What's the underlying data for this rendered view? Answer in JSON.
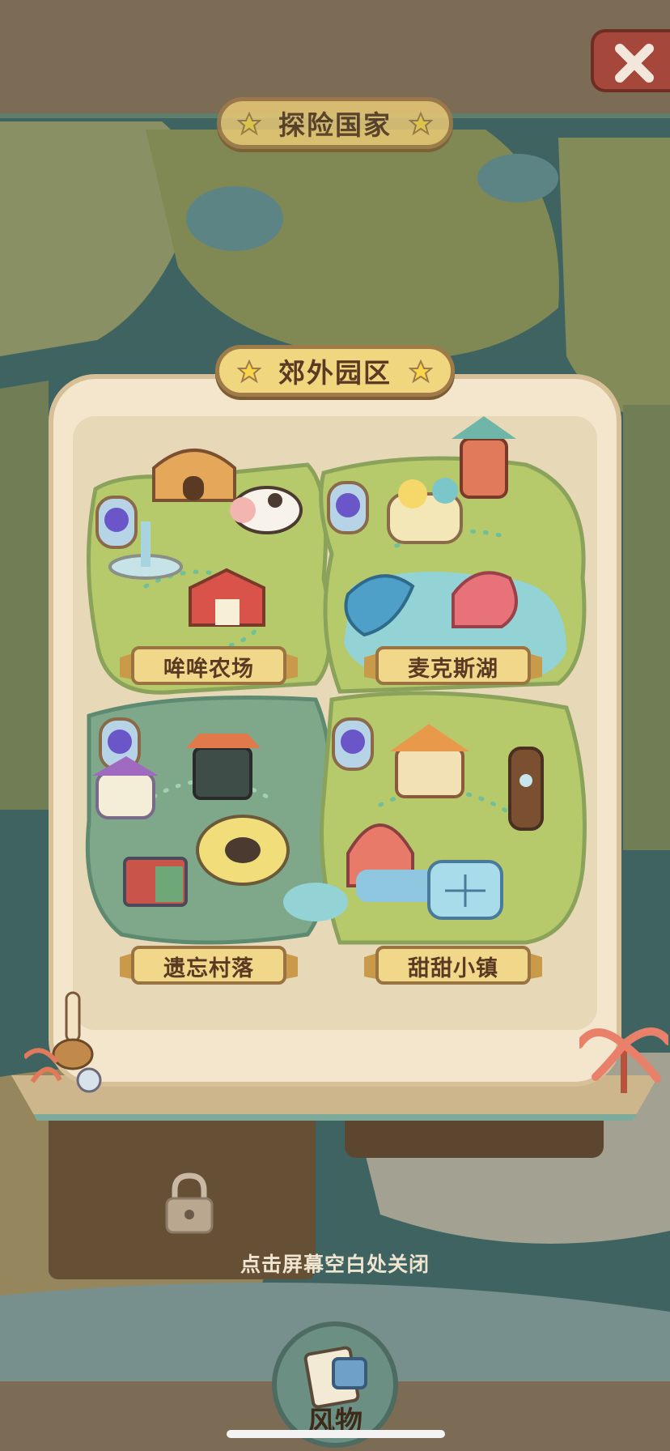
{
  "header": {
    "country_title": "探险国家",
    "close_icon": "close-x-icon"
  },
  "region": {
    "title": "郊外园区",
    "areas": [
      {
        "id": "moo-farm",
        "label": "哞哞农场"
      },
      {
        "id": "max-lake",
        "label": "麦克斯湖"
      },
      {
        "id": "forgotten-village",
        "label": "遗忘村落"
      },
      {
        "id": "sweet-town",
        "label": "甜甜小镇"
      }
    ]
  },
  "hint": "点击屏幕空白处关闭",
  "bottom": {
    "button_label": "风物"
  },
  "colors": {
    "plaque": "#e9c976",
    "parchment": "#f4e6cc",
    "grass": "#b8cc6e",
    "water": "#8fd0d4",
    "close": "#a5483b"
  }
}
